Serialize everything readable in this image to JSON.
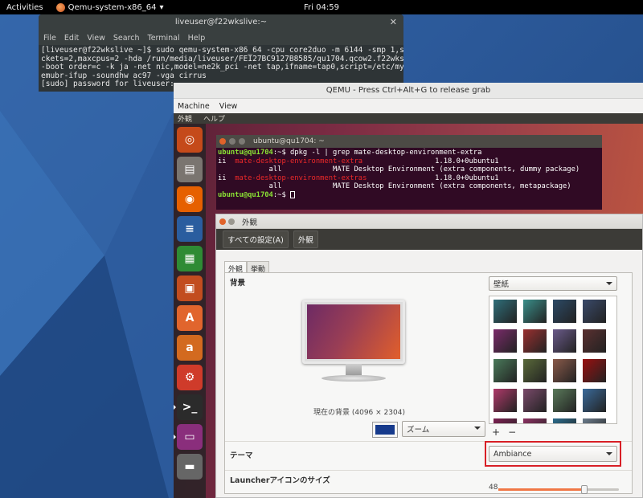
{
  "host": {
    "topbar": {
      "activities": "Activities",
      "app_name": "Qemu-system-x86_64",
      "clock": "Fri 04:59"
    },
    "terminal": {
      "title": "liveuser@f22wkslive:~",
      "menu": [
        "File",
        "Edit",
        "View",
        "Search",
        "Terminal",
        "Help"
      ],
      "lines": [
        "[liveuser@f22wkslive ~]$ sudo qemu-system-x86_64 -cpu core2duo -m 6144 -smp 1,so",
        "ckets=2,maxcpus=2 -hda /run/media/liveuser/FEI27BC9127B8585/qu1704.qcow2.f22wks",
        "-boot order=c -k ja -net nic,model=ne2k_pci -net tap,ifname=tap0,script=/etc/myq",
        "emubr-ifup -soundhw ac97 -vga cirrus",
        "[sudo] password for liveuser: "
      ]
    }
  },
  "qemu": {
    "title": "QEMU - Press Ctrl+Alt+G to release grab",
    "menu": [
      "Machine",
      "View"
    ],
    "guest": {
      "panel_menu": [
        "外観",
        "ヘルプ"
      ],
      "launcher": [
        {
          "name": "ubuntu-dash-icon",
          "color": "#c54a1a"
        },
        {
          "name": "files-icon",
          "color": "#7a7570"
        },
        {
          "name": "firefox-icon",
          "color": "#e66000"
        },
        {
          "name": "libreoffice-writer-icon",
          "color": "#2a5d9f"
        },
        {
          "name": "libreoffice-calc-icon",
          "color": "#2e8b34"
        },
        {
          "name": "libreoffice-impress-icon",
          "color": "#c24d1f"
        },
        {
          "name": "software-center-icon",
          "color": "#e1652d"
        },
        {
          "name": "amazon-icon",
          "color": "#d36a1f"
        },
        {
          "name": "system-settings-icon",
          "color": "#cf3b2a"
        },
        {
          "name": "terminal-icon",
          "color": "#2b2b2b"
        },
        {
          "name": "appearance-icon",
          "color": "#8a2e7c"
        },
        {
          "name": "drive-icon",
          "color": "#666"
        }
      ],
      "terminal": {
        "title": "ubuntu@qu1704: ~",
        "prompt": "ubuntu@qu1704",
        "cmd": ":~$ dpkg -l | grep mate-desktop-environment-extra",
        "row1_pkg": "mate-desktop-environment-extra",
        "row1_ver": "                 1.18.0+0ubuntu1",
        "row1_desc": "            all            MATE Desktop Environment (extra components, dummy package)",
        "row2_pkg": "mate-desktop-environment-extras",
        "row2_ver": "                1.18.0+0ubuntu1",
        "row2_desc": "            all            MATE Desktop Environment (extra components, metapackage)",
        "ii": "ii  ",
        "prompt2_suffix": ":~$ "
      },
      "appearance": {
        "title": "外観",
        "crumbs": [
          "すべての設定(A)",
          "外観"
        ],
        "tabs": [
          "外観",
          "挙動"
        ],
        "background_label": "背景",
        "current_bg": "現在の背景 (4096 × 2304)",
        "wallpaper_combo": "壁紙",
        "zoom_combo": "ズーム",
        "swatch_color": "#163a8c",
        "theme_label": "テーマ",
        "theme_value": "Ambiance",
        "launcher_size_label": "Launcherアイコンのサイズ",
        "launcher_size_value": "48",
        "add_button": "+",
        "remove_button": "−",
        "thumbnails": [
          "#2f6f7a",
          "#3a8f8a",
          "#2c4a66",
          "#3a4a6a",
          "#7a2b6a",
          "#9a3030",
          "#6a5a8a",
          "#5a3030",
          "#4a7a5a",
          "#5a6a3a",
          "#8a5a4a",
          "#9a1010",
          "#b03a6a",
          "#7a4a6a",
          "#5a7a5a",
          "#3a6a9a",
          "#7a2050",
          "#8a3060",
          "#2a6a8a",
          "#6a7a8a"
        ]
      }
    }
  }
}
